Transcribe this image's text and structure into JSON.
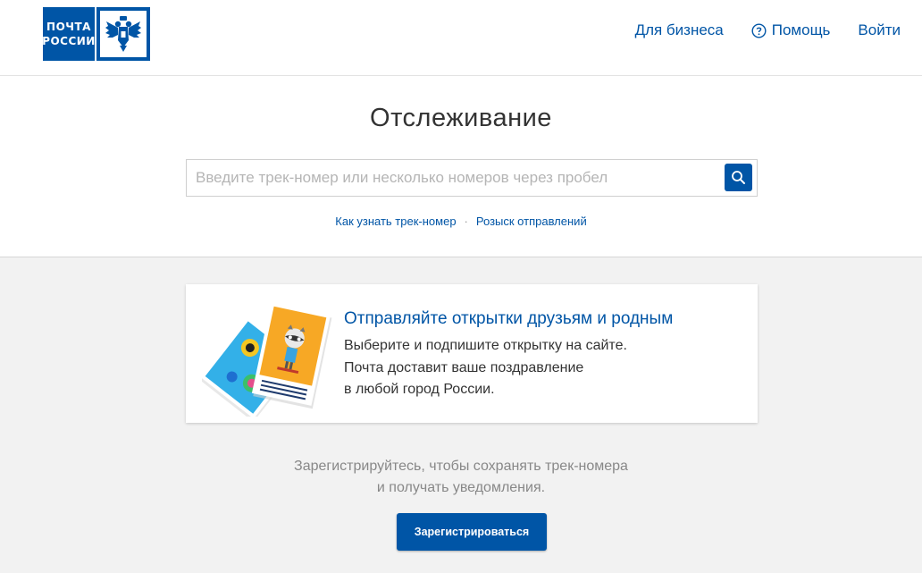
{
  "header": {
    "logo_line1": "ПОЧТА",
    "logo_line2": "РОССИИ",
    "nav": {
      "business": "Для бизнеса",
      "help": "Помощь",
      "login": "Войти"
    }
  },
  "tracking": {
    "title": "Отслеживание",
    "search_placeholder": "Введите трек-номер или несколько номеров через пробел",
    "search_value": "",
    "link_how": "Как узнать трек-номер",
    "link_separator": "·",
    "link_search": "Розыск отправлений"
  },
  "promo": {
    "title": "Отправляйте открытки друзьям и родным",
    "lines": [
      "Выберите и подпишите открытку на сайте.",
      "Почта доставит ваше поздравление",
      "в любой город России."
    ]
  },
  "register": {
    "line1": "Зарегистрируйтесь, чтобы сохранять трек-номера",
    "line2": "и получать уведомления.",
    "button": "Зарегистрироваться"
  },
  "colors": {
    "brand_blue": "#0055a6",
    "background": "#f2f2f2"
  },
  "icons": [
    "eagle-emblem-icon",
    "help-circle-icon",
    "search-icon",
    "postcards-illustration"
  ]
}
